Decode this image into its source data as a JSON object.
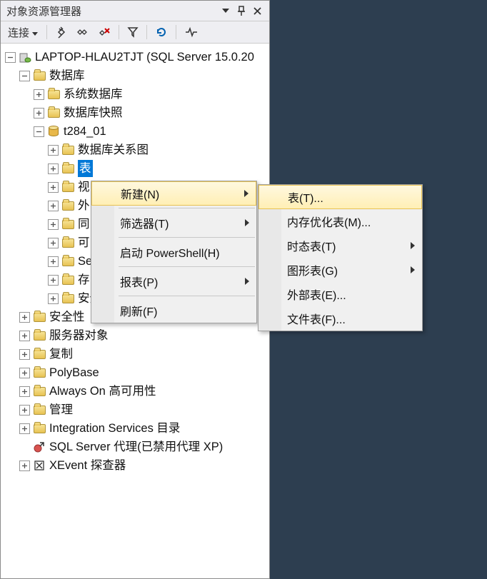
{
  "panel": {
    "title": "对象资源管理器",
    "connect_label": "连接"
  },
  "tree": {
    "server": "LAPTOP-HLAU2TJT (SQL Server 15.0.20",
    "databases": "数据库",
    "system_db": "系统数据库",
    "db_snapshot": "数据库快照",
    "db_name": "t284_01",
    "db_diagrams": "数据库关系图",
    "tables": "表",
    "views": "视",
    "external": "外",
    "synonyms": "同",
    "programmability": "可",
    "service_broker": "Se",
    "storage": "存",
    "db_security": "安全性",
    "security": "安全性",
    "server_objects": "服务器对象",
    "replication": "复制",
    "polybase": "PolyBase",
    "always_on": "Always On 高可用性",
    "management": "管理",
    "integration": "Integration Services 目录",
    "agent": "SQL Server 代理(已禁用代理 XP)",
    "xevent": "XEvent 探查器"
  },
  "menu1": {
    "new": "新建(N)",
    "filter": "筛选器(T)",
    "powershell": "启动 PowerShell(H)",
    "reports": "报表(P)",
    "refresh": "刷新(F)"
  },
  "menu2": {
    "table": "表(T)...",
    "memory": "内存优化表(M)...",
    "temporal": "时态表(T)",
    "graph": "图形表(G)",
    "external": "外部表(E)...",
    "file": "文件表(F)..."
  }
}
